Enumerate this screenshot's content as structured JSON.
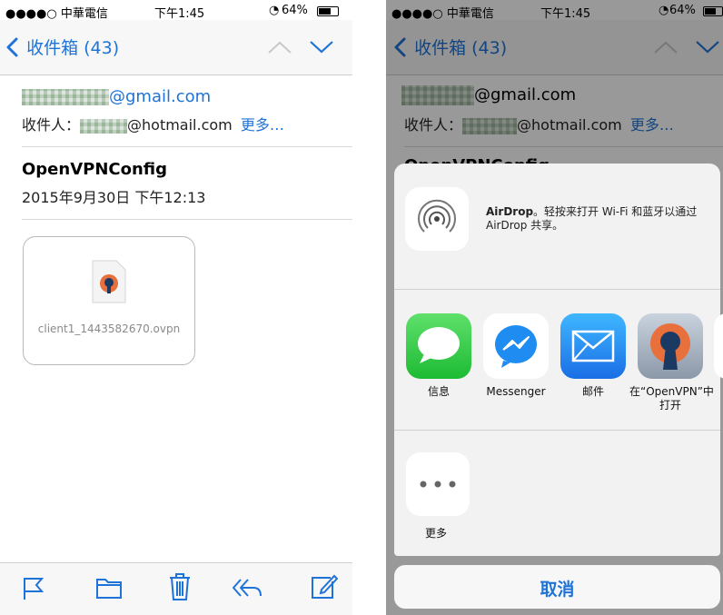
{
  "left": {
    "status": {
      "carrier": "●●●●○ 中華電信",
      "time": "下午1:45",
      "battery": "64%"
    },
    "nav": {
      "back_label": "收件箱 (43)"
    },
    "message": {
      "from": "@gmail.com",
      "to_prefix": "收件人：",
      "to_address": "@hotmail.com",
      "more_link": "更多…",
      "subject": "OpenVPNConfig",
      "date": "2015年9月30日 下午12:13"
    },
    "attachment": {
      "filename": "client1_1443582670.ovpn"
    }
  },
  "right": {
    "status": {
      "carrier": "●●●●○ 中華電信",
      "time": "下午1:45",
      "battery": "64%"
    },
    "nav": {
      "back_label": "收件箱 (43)"
    },
    "message": {
      "from": "@gmail.com",
      "to_prefix": "收件人：",
      "to_address": "@hotmail.com",
      "more_link": "更多…",
      "subject_partial": "OpenVPNConfig"
    },
    "airdrop": {
      "title": "AirDrop",
      "description": "。轻按来打开 Wi-Fi 和蓝牙以通过 AirDrop 共享。"
    },
    "apps": [
      {
        "label": "信息",
        "icon": "messages-icon"
      },
      {
        "label": "Messenger",
        "icon": "messenger-icon"
      },
      {
        "label": "邮件",
        "icon": "mail-icon"
      },
      {
        "label": "在“OpenVPN”中打开",
        "icon": "openvpn-icon"
      }
    ],
    "more_label": "更多",
    "cancel_label": "取消"
  }
}
